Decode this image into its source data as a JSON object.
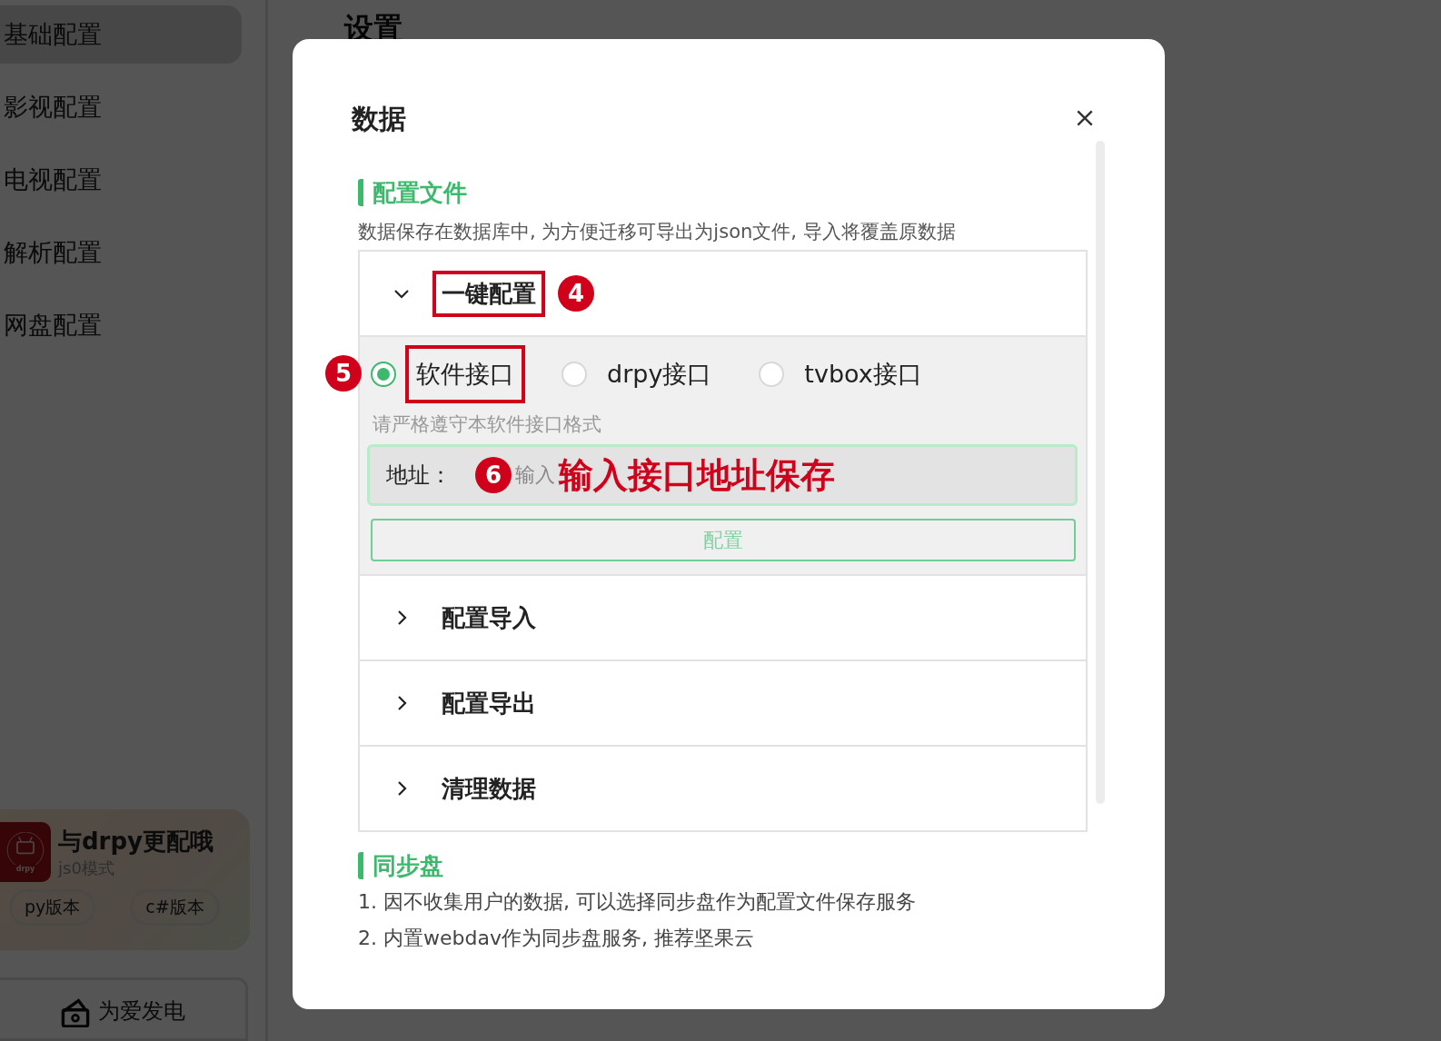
{
  "sidebar": {
    "items": [
      {
        "label": "基础配置",
        "selected": true
      },
      {
        "label": "影视配置",
        "selected": false
      },
      {
        "label": "电视配置",
        "selected": false
      },
      {
        "label": "解析配置",
        "selected": false
      },
      {
        "label": "网盘配置",
        "selected": false
      }
    ],
    "promo": {
      "logo_text": "drpy",
      "title": "与drpy更配哦",
      "subtitle": "js0模式",
      "buttons": [
        "py版本",
        "c#版本"
      ]
    },
    "donate": {
      "label": "为爱发电"
    }
  },
  "page_title": "设置",
  "dialog": {
    "title": "数据",
    "sections": [
      {
        "heading": "配置文件",
        "description": "数据保存在数据库中, 为方便迁移可导出为json文件, 导入将覆盖原数据",
        "panels": [
          {
            "title": "一键配置",
            "expanded": true,
            "highlighted": true,
            "marker": "4",
            "options": [
              {
                "label": "软件接口",
                "selected": true,
                "highlighted": true
              },
              {
                "label": "drpy接口",
                "selected": false,
                "highlighted": false
              },
              {
                "label": "tvbox接口",
                "selected": false,
                "highlighted": false
              }
            ],
            "options_marker": "5",
            "hint": "请严格遵守本软件接口格式",
            "field": {
              "label": "地址：",
              "placeholder": "输入",
              "marker": "6",
              "note": "输入接口地址保存"
            },
            "button": "配置"
          },
          {
            "title": "配置导入",
            "expanded": false,
            "highlighted": false
          },
          {
            "title": "配置导出",
            "expanded": false,
            "highlighted": false
          },
          {
            "title": "清理数据",
            "expanded": false,
            "highlighted": false
          }
        ]
      },
      {
        "heading": "同步盘",
        "lines": [
          "1. 因不收集用户的数据, 可以选择同步盘作为配置文件保存服务",
          "2. 内置webdav作为同步盘服务, 推荐坚果云"
        ]
      }
    ]
  }
}
